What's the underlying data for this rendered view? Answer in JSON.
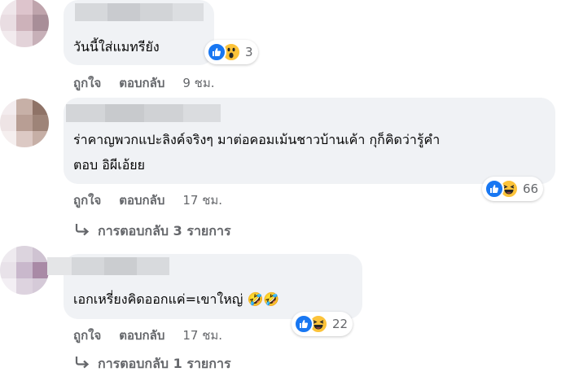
{
  "comments": [
    {
      "text": "วันนี้ใส่แมทรียัง",
      "reaction_count": "3",
      "like_label": "ถูกใจ",
      "reply_label": "ตอบกลับ",
      "time": "9 ชม."
    },
    {
      "text_line1": "ร่าคาญพวกแปะลิงค์จริงๆ มาต่อคอมเม้นชาวบ้านเค้า กุก็คิดว่ารู้คำ",
      "text_line2": "ตอบ อิผีเอ้ยย",
      "reaction_count": "66",
      "like_label": "ถูกใจ",
      "reply_label": "ตอบกลับ",
      "time": "17 ชม.",
      "view_replies": "การตอบกลับ 3 รายการ"
    },
    {
      "text": "เอกเหรี่ยงคิดออกแค่=เขาใหญ่",
      "emoji": "🤣🤣",
      "reaction_count": "22",
      "like_label": "ถูกใจ",
      "reply_label": "ตอบกลับ",
      "time": "17 ชม.",
      "view_replies": "การตอบกลับ 1 รายการ"
    }
  ],
  "colors": {
    "bubble": "#f0f2f5",
    "secondary_text": "#65676b",
    "like_blue": "#1877f2",
    "emoji_yellow": "#fcc33a"
  },
  "icons": {
    "like": "thumbs-up-icon",
    "wow": "wow-face-icon",
    "haha": "laughing-face-icon",
    "reply_arrow": "reply-arrow-icon"
  }
}
